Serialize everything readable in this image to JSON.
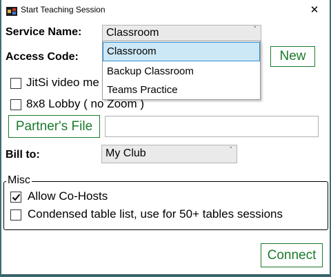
{
  "window": {
    "title": "Start Teaching Session"
  },
  "service": {
    "label": "Service Name:",
    "selected": "Classroom",
    "options": [
      "Classroom",
      "Backup Classroom",
      "Teams Practice"
    ]
  },
  "access_code": {
    "label": "Access Code:",
    "new_label": "New"
  },
  "jitsi": {
    "label": "JitSi video me",
    "checked": false
  },
  "lobby": {
    "label": "8x8 Lobby ( no Zoom )",
    "checked": false
  },
  "partner_file": {
    "button_label": "Partner's File",
    "value": ""
  },
  "bill_to": {
    "label": "Bill to:",
    "selected": "My Club"
  },
  "misc": {
    "title": "Misc",
    "allow_cohosts": {
      "label": "Allow Co-Hosts",
      "checked": true
    },
    "condensed": {
      "label": "Condensed table list, use for 50+ tables sessions",
      "checked": false
    }
  },
  "connect_label": "Connect",
  "colors": {
    "accent_green": "#1a7a2a",
    "selection_bg": "#cce8f6",
    "selection_border": "#2f8dd8"
  }
}
